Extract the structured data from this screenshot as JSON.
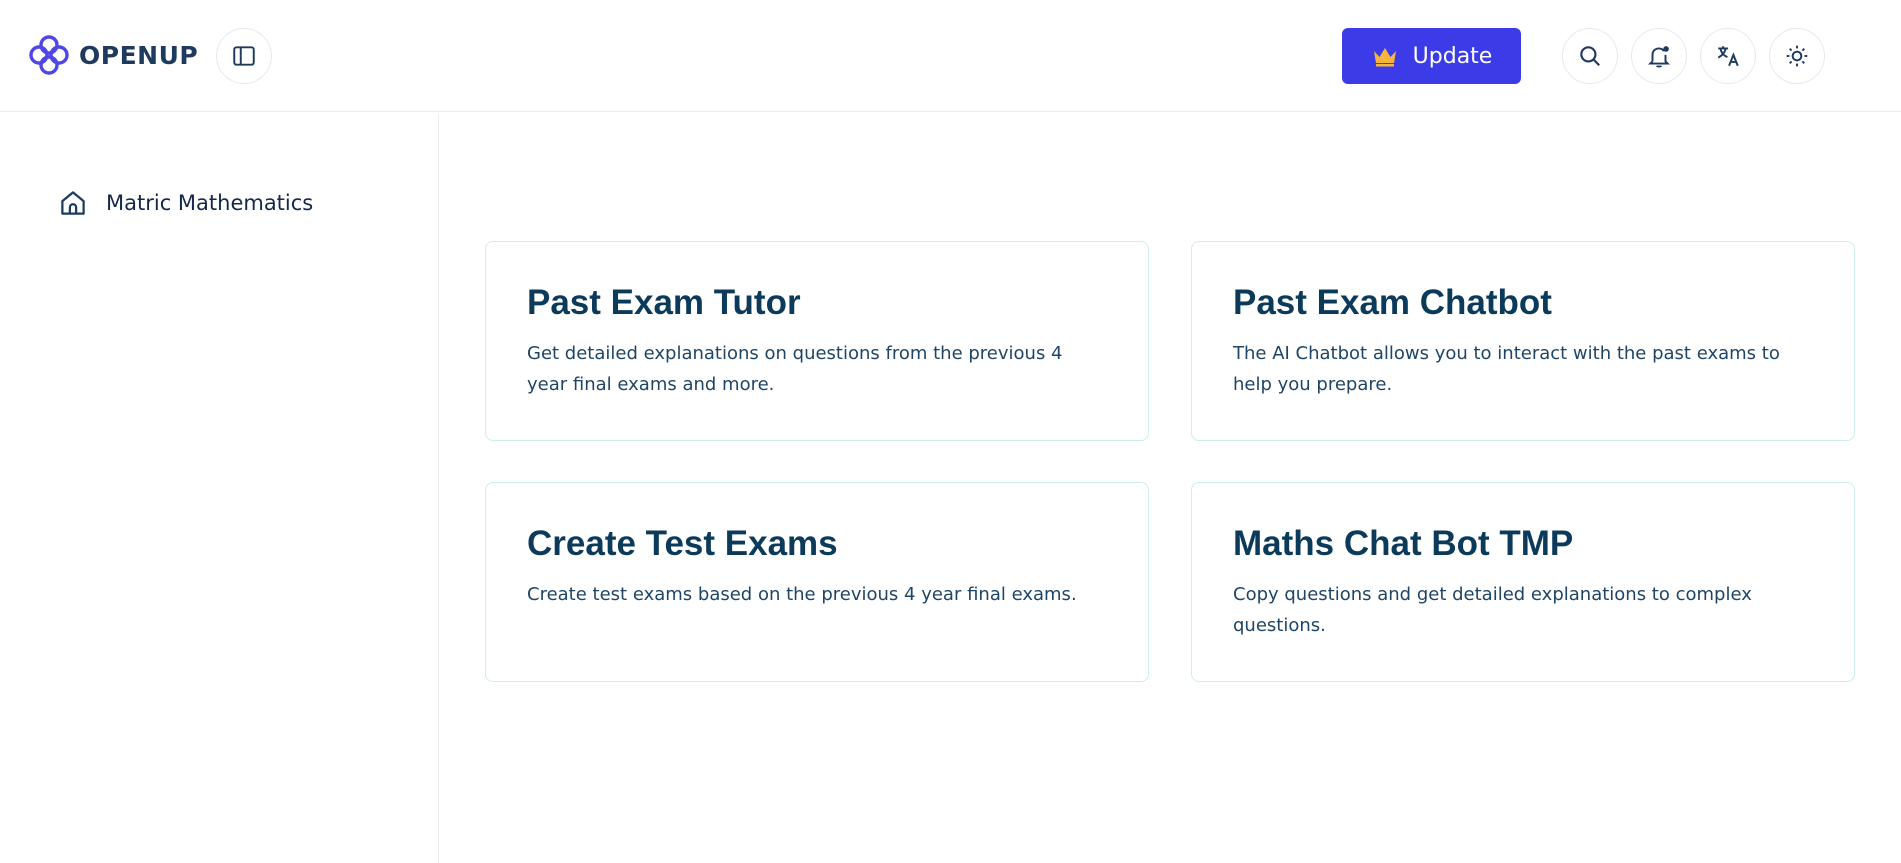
{
  "header": {
    "logo_text": "OPENUP",
    "update_label": "Update"
  },
  "sidebar": {
    "items": [
      {
        "label": "Matric Mathematics",
        "icon": "home-icon"
      }
    ]
  },
  "cards": [
    {
      "title": "Past Exam Tutor",
      "description": "Get detailed explanations on questions from the previous 4 year final exams and more."
    },
    {
      "title": "Past Exam Chatbot",
      "description": "The AI Chatbot allows you to interact with the past exams to help you prepare."
    },
    {
      "title": "Create Test Exams",
      "description": "Create test exams based on the previous 4 year final exams."
    },
    {
      "title": "Maths Chat Bot TMP",
      "description": "Copy questions and get detailed explanations to complex questions."
    }
  ],
  "colors": {
    "accent": "#3b3be8",
    "crown": "#f4b63f",
    "text_primary": "#0b3a5b",
    "card_border": "#cdeee8"
  }
}
